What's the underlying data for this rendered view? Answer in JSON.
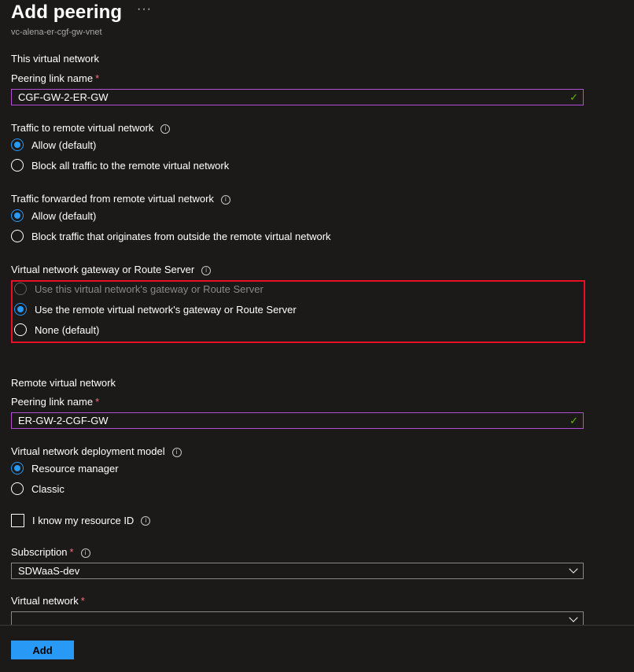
{
  "header": {
    "title": "Add peering",
    "more_label": "···",
    "subtitle": "vc-alena-er-cgf-gw-vnet"
  },
  "this_network": {
    "section_title": "This virtual network",
    "peering_link_label": "Peering link name",
    "required_mark": "*",
    "peering_link_value": "CGF-GW-2-ER-GW",
    "traffic_to_remote": {
      "label": "Traffic to remote virtual network",
      "options": [
        "Allow (default)",
        "Block all traffic to the remote virtual network"
      ],
      "selected": 0
    },
    "traffic_forwarded": {
      "label": "Traffic forwarded from remote virtual network",
      "options": [
        "Allow (default)",
        "Block traffic that originates from outside the remote virtual network"
      ],
      "selected": 0
    },
    "gateway": {
      "label": "Virtual network gateway or Route Server",
      "options": [
        "Use this virtual network's gateway or Route Server",
        "Use the remote virtual network's gateway or Route Server",
        "None (default)"
      ],
      "selected": 1,
      "disabled": [
        0
      ],
      "highlight_color": "#e81123"
    }
  },
  "remote_network": {
    "section_title": "Remote virtual network",
    "peering_link_label": "Peering link name",
    "required_mark": "*",
    "peering_link_value": "ER-GW-2-CGF-GW",
    "deployment_model": {
      "label": "Virtual network deployment model",
      "options": [
        "Resource manager",
        "Classic"
      ],
      "selected": 0
    },
    "know_resource_id_label": "I know my resource ID",
    "know_resource_id_checked": false,
    "subscription_label": "Subscription",
    "subscription_value": "SDWaaS-dev",
    "virtual_network_label": "Virtual network",
    "virtual_network_value": ""
  },
  "footer": {
    "add_label": "Add"
  },
  "icons": {
    "info": "info-icon",
    "check": "checkmark-icon",
    "chevron": "chevron-down-icon",
    "more": "ellipsis-icon"
  },
  "colors": {
    "accent": "#2899f5",
    "field_focus_border": "#b24fd6",
    "valid_check": "#6bb700",
    "required": "#f1707b",
    "background": "#1b1a19"
  }
}
